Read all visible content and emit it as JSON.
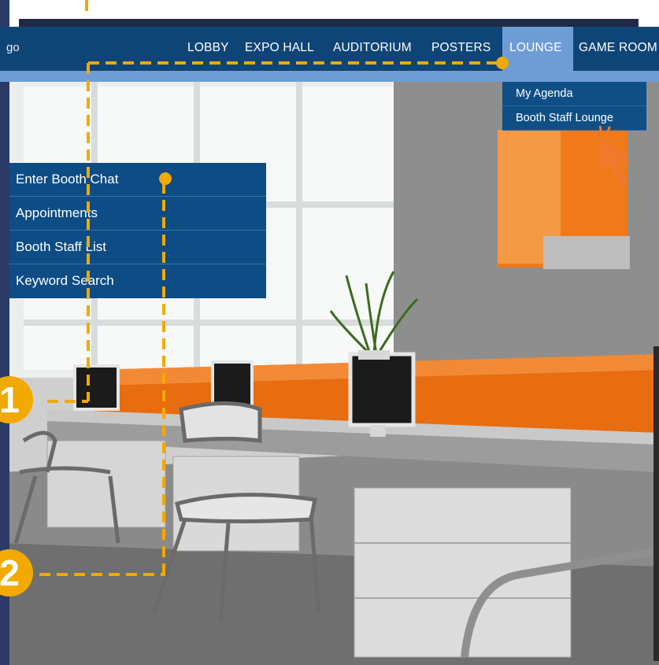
{
  "nav": {
    "logo_text": "go",
    "items": [
      {
        "label": "LOBBY"
      },
      {
        "label": "EXPO HALL"
      },
      {
        "label": "AUDITORIUM"
      },
      {
        "label": "POSTERS"
      },
      {
        "label": "LOUNGE",
        "active": true
      },
      {
        "label": "GAME ROOM"
      }
    ]
  },
  "lounge_dropdown": {
    "items": [
      {
        "label": "My Agenda"
      },
      {
        "label": "Booth Staff Lounge"
      }
    ]
  },
  "booth_menu": {
    "items": [
      {
        "label": "Enter Booth Chat"
      },
      {
        "label": "Appointments"
      },
      {
        "label": "Booth Staff List"
      },
      {
        "label": "Keyword Search"
      }
    ]
  },
  "annotations": {
    "step_1": "1",
    "step_2": "2"
  },
  "colors": {
    "nav_bg": "#0f4576",
    "nav_active": "#6e9dd6",
    "menu_bg": "#0d4c84",
    "accent": "#f2a900",
    "cursor": "#f07a2c"
  }
}
